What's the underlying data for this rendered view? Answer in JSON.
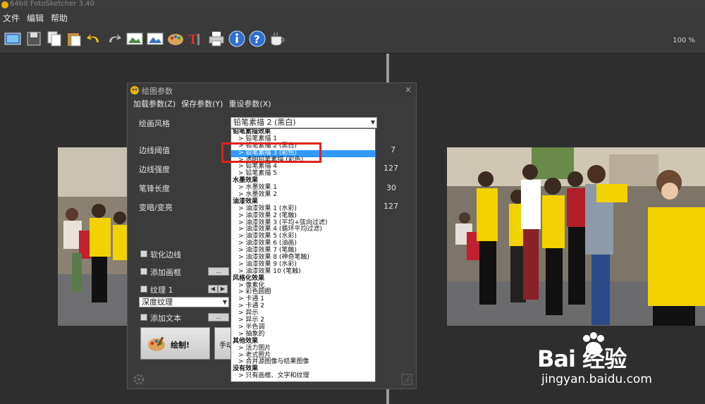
{
  "window": {
    "title": "64bit FotoSketcher 3.40"
  },
  "menu": {
    "items": [
      "文件",
      "编辑",
      "帮助"
    ]
  },
  "toolbar": {
    "zoom": "100 %",
    "icons": [
      "open-image-icon",
      "save-icon",
      "copy-icon",
      "paste-icon",
      "undo-icon",
      "redo-icon",
      "original-image-icon",
      "result-image-icon",
      "palette-icon",
      "text-icon",
      "print-icon",
      "info-icon",
      "help-icon",
      "coffee-icon"
    ]
  },
  "dialog": {
    "title": "绘图参数",
    "close": "×",
    "menu": {
      "load": "加载参数(Z)",
      "save": "保存参数(Y)",
      "reset": "重设参数(X)"
    },
    "style_label": "绘画风格",
    "style_value": "铅笔素描 2 (黑白)",
    "params": [
      {
        "label": "边线阈值",
        "value": "7"
      },
      {
        "label": "边线强度",
        "value": "127"
      },
      {
        "label": "笔锋长度",
        "value": "30"
      },
      {
        "label": "变暗/变亮",
        "value": "127"
      }
    ],
    "soften_edges": "软化边线",
    "add_frame": "添加画框",
    "texture": "纹理 1",
    "texture_type": "深度纹理",
    "add_text": "添加文本",
    "draw_button": "绘制!",
    "hand_button": "手动",
    "ellipsis": "..."
  },
  "dropdown": {
    "selected_index": 3,
    "rows": [
      {
        "text": "铅笔素描效果",
        "type": "cat"
      },
      {
        "text": "> 铅笔素描 1",
        "type": "item"
      },
      {
        "text": "> 铅笔素描 2 (黑白)",
        "type": "item"
      },
      {
        "text": "> 铅笔素描 3 (彩色)",
        "type": "item"
      },
      {
        "text": "> 透明铅笔素描 (彩色)",
        "type": "item"
      },
      {
        "text": "> 铅笔素描 4",
        "type": "item"
      },
      {
        "text": "> 铅笔素描 5",
        "type": "item"
      },
      {
        "text": "水墨效果",
        "type": "cat"
      },
      {
        "text": "> 水墨效果 1",
        "type": "item"
      },
      {
        "text": "> 水墨效果 2",
        "type": "item"
      },
      {
        "text": "油漆效果",
        "type": "cat"
      },
      {
        "text": "> 油漆效果 1 (水彩)",
        "type": "item"
      },
      {
        "text": "> 油漆效果 2 (笔触)",
        "type": "item"
      },
      {
        "text": "> 油漆效果 3 (平均+弦向过滤)",
        "type": "item"
      },
      {
        "text": "> 油漆效果 4 (循环平均过滤)",
        "type": "item"
      },
      {
        "text": "> 油漆效果 5 (水彩)",
        "type": "item"
      },
      {
        "text": "> 油漆效果 6 (油画)",
        "type": "item"
      },
      {
        "text": "> 油漆效果 7 (笔触)",
        "type": "item"
      },
      {
        "text": "> 油漆效果 8 (神奇笔触)",
        "type": "item"
      },
      {
        "text": "> 油漆效果 9 (水彩)",
        "type": "item"
      },
      {
        "text": "> 油漆效果 10 (笔触)",
        "type": "item"
      },
      {
        "text": "风格化效果",
        "type": "cat"
      },
      {
        "text": "> 像素化",
        "type": "item"
      },
      {
        "text": "> 彩色圆圈",
        "type": "item"
      },
      {
        "text": "> 卡通 1",
        "type": "item"
      },
      {
        "text": "> 卡通 2",
        "type": "item"
      },
      {
        "text": "> 异示",
        "type": "item"
      },
      {
        "text": "> 异示 2",
        "type": "item"
      },
      {
        "text": "> 半色调",
        "type": "item"
      },
      {
        "text": "> 抽象的",
        "type": "item"
      },
      {
        "text": "其他效果",
        "type": "cat"
      },
      {
        "text": "> 活力图片",
        "type": "item"
      },
      {
        "text": "> 老式照片",
        "type": "item"
      },
      {
        "text": "> 合并源图像与结果图像",
        "type": "item"
      },
      {
        "text": "没有效果",
        "type": "cat"
      },
      {
        "text": "> 只有画框、文字和纹理",
        "type": "item"
      }
    ]
  },
  "watermark": {
    "brand": "Bai 经验",
    "url": "jingyan.baidu.com"
  },
  "colors": {
    "selection": "#3399ff",
    "highlight": "#e02020",
    "shirt": "#f2d200"
  }
}
